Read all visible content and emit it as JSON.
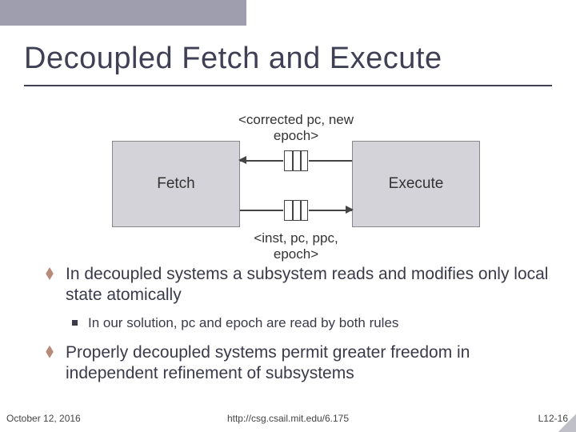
{
  "title": "Decoupled Fetch and Execute",
  "diagram": {
    "fetch_label": "Fetch",
    "exec_label": "Execute",
    "top_msg": "<corrected pc, new epoch>",
    "bot_msg": "<inst, pc, ppc, epoch>"
  },
  "bullets": {
    "p1": "In decoupled systems a subsystem reads and modifies only local state atomically",
    "p1_sub": "In our solution, pc and epoch are read by both rules",
    "p2": "Properly decoupled systems permit greater freedom in independent refinement of subsystems"
  },
  "footer": {
    "date": "October 12, 2016",
    "url": "http://csg.csail.mit.edu/6.175",
    "slide": "L12-16"
  }
}
